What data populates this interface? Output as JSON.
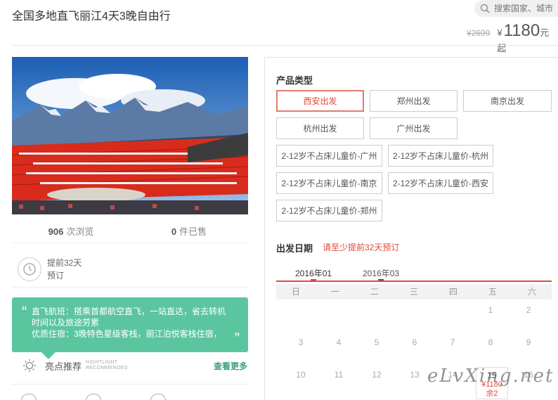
{
  "header": {
    "title": "全国多地直飞丽江4天3晚自由行",
    "search_placeholder": "搜索国家、城市",
    "price_old": "¥2699",
    "price_currency": "¥",
    "price_value": "1180",
    "price_suffix": "元起"
  },
  "stats": {
    "views_count": "906",
    "views_label": "次浏览",
    "sold_count": "0",
    "sold_label": "件已售"
  },
  "advance": {
    "line1": "提前32天",
    "line2": "预订"
  },
  "highlight": {
    "line1": "直飞航班：搭乘首都航空直飞，一站直达，省去转机",
    "line2": "时间以及旅途劳累",
    "line3": "优质住宿：3晚特色星级客栈，丽江泊悦客栈住宿，",
    "open_quote": "“",
    "close_quote": "”"
  },
  "bright": {
    "label": "亮点推荐",
    "en_line1": "HIGHTLIGHT",
    "en_line2": "RECOMMENDED",
    "more": "查看更多"
  },
  "product": {
    "title": "产品类型",
    "options": [
      "西安出发",
      "郑州出发",
      "南京出发",
      "杭州出发",
      "广州出发",
      "2-12岁不占床儿童价-广州",
      "2-12岁不占床儿童价-杭州",
      "2-12岁不占床儿童价-南京",
      "2-12岁不占床儿童价-西安",
      "2-12岁不占床儿童价-郑州"
    ],
    "selected": "西安出发"
  },
  "departure": {
    "title": "出发日期",
    "notice": "请至少提前32天预订",
    "months": [
      "2016年01",
      "2016年03"
    ],
    "weekdays": [
      "日",
      "一",
      "二",
      "三",
      "四",
      "五",
      "六"
    ],
    "row1": [
      "1",
      "2"
    ],
    "row2": [
      "3",
      "4",
      "5",
      "6",
      "7",
      "8",
      "9"
    ],
    "row3": [
      "10",
      "11",
      "12",
      "13",
      "14"
    ],
    "row3_last": "16",
    "active_day": "15",
    "active_price": "¥1180",
    "active_remaining": "余2"
  },
  "watermark": "eLvXing.net",
  "colors": {
    "accent_red": "#e04a3c",
    "highlight_green": "#5bc5a0"
  }
}
